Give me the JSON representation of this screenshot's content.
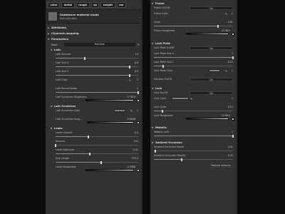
{
  "tabs": [
    "color",
    "metal",
    "rough",
    "ao",
    "height",
    "nm"
  ],
  "substance": {
    "title": "Substance material mode",
    "name": "RollingShutter",
    "menu": "..."
  },
  "left": {
    "attributes": "Attributes",
    "channels": "Channels mapping",
    "parameters": "Parameters",
    "seed": {
      "label": "Seed",
      "value": "Random"
    },
    "lath": {
      "title": "Lath",
      "amount": {
        "label": "Lath Amount",
        "value": "10",
        "level": 0.35
      },
      "size_x": {
        "label": "Lath Size X",
        "value": "0.9",
        "level": 0.9
      },
      "size_y": {
        "label": "Lath Size Y",
        "value": "0.9",
        "level": 0.9
      },
      "color": {
        "label": "Lath Color",
        "value": "1"
      },
      "round": {
        "label": "Lath Round Shape",
        "value": "1",
        "level": 1.0
      },
      "scratches_rough": {
        "label": "Lath Scratches Roughness",
        "value": "0.7615"
      }
    },
    "scratches": {
      "title": "Lath Scratches",
      "color": {
        "label": "Lath Scratches Color",
        "value": "1"
      },
      "rough": {
        "label": "Lath Scratches Roug...",
        "value": "0.9048"
      }
    },
    "leaks": {
      "title": "Leaks",
      "amount": {
        "label": "Leaks Amount",
        "value": "0.4",
        "level": 0.4
      },
      "angle": {
        "label": "Amount",
        "value": "0.%",
        "level": 0.0
      },
      "lightness": {
        "label": "Leaks Lightness",
        "value": "0.41",
        "level": 0.41
      },
      "drip": {
        "label": "Drip Length",
        "value": "137.2",
        "level": 0.55
      },
      "rough": {
        "label": "Leaks Roughness",
        "value": "0.3586"
      }
    }
  },
  "right": {
    "frame": {
      "title": "Frame",
      "onoff": {
        "label": "Frame On/Off",
        "value": "On"
      },
      "color": {
        "label": "Frame Color",
        "value": "1"
      },
      "scale": {
        "label": "Scale",
        "value": "0.81",
        "level": 0.81
      },
      "rough": {
        "label": "Frame Roughness",
        "value": "0.7612"
      }
    },
    "lock_plate": {
      "title": "Lock Plate",
      "onoff": {
        "label": "Lock Plate On/Off",
        "value": "On"
      },
      "size_x": {
        "label": "Lock Plate Size X",
        "value": "1",
        "level": 1.0
      },
      "size_y": {
        "label": "Lock Plate Size Y",
        "value": "0.12",
        "level": 0.12
      },
      "color": {
        "label": "Lock Plate Color",
        "value": "1"
      },
      "handles": {
        "label": "Handles On/Off",
        "value": "On"
      }
    },
    "lock": {
      "title": "Lock",
      "onoff": {
        "label": "Lock On/Off",
        "value": "On"
      },
      "color": {
        "label": "Lock Color",
        "value": "1"
      },
      "scale": {
        "label": "Lock Scale",
        "value": "0.11",
        "level": 0.11
      },
      "rough": {
        "label": "Lock Roughness",
        "value": "0.7613"
      }
    },
    "metallic": {
      "title": "Metallic",
      "lock": {
        "label": "Metallic Lock",
        "value": "1",
        "level": 1.0
      }
    },
    "ao": {
      "title": "Ambient Occlusion",
      "depth": {
        "label": "Ambient Occlusion Depth",
        "value": "0.02",
        "level": 0.02
      },
      "opacity": {
        "label": "Ambient Occlusion Opacity",
        "value": "0.35",
        "level": 0.35
      }
    },
    "restore": "Restore defaults"
  }
}
